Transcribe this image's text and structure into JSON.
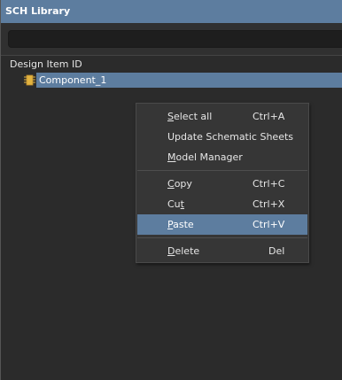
{
  "window": {
    "title": "SCH Library"
  },
  "search": {
    "value": "",
    "placeholder": ""
  },
  "list": {
    "column_header": "Design Item ID",
    "items": [
      {
        "label": "Component_1",
        "icon": "component-icon",
        "selected": true
      }
    ]
  },
  "context_menu": {
    "items": [
      {
        "label_pre": "",
        "label_ul": "S",
        "label_post": "elect all",
        "shortcut": "Ctrl+A"
      },
      {
        "label_pre": "Update Schematic Sheets",
        "label_ul": "",
        "label_post": "",
        "shortcut": ""
      },
      {
        "label_pre": "",
        "label_ul": "M",
        "label_post": "odel Manager",
        "shortcut": ""
      },
      {
        "label_pre": "",
        "label_ul": "C",
        "label_post": "opy",
        "shortcut": "Ctrl+C"
      },
      {
        "label_pre": "Cu",
        "label_ul": "t",
        "label_post": "",
        "shortcut": "Ctrl+X"
      },
      {
        "label_pre": "",
        "label_ul": "P",
        "label_post": "aste",
        "shortcut": "Ctrl+V",
        "highlighted": true
      },
      {
        "label_pre": "",
        "label_ul": "D",
        "label_post": "elete",
        "shortcut": "Del"
      }
    ]
  },
  "colors": {
    "title_bar": "#5d7d9f",
    "selection": "#5d7d9f",
    "background": "#2b2b2b",
    "menu_background": "#363636"
  }
}
